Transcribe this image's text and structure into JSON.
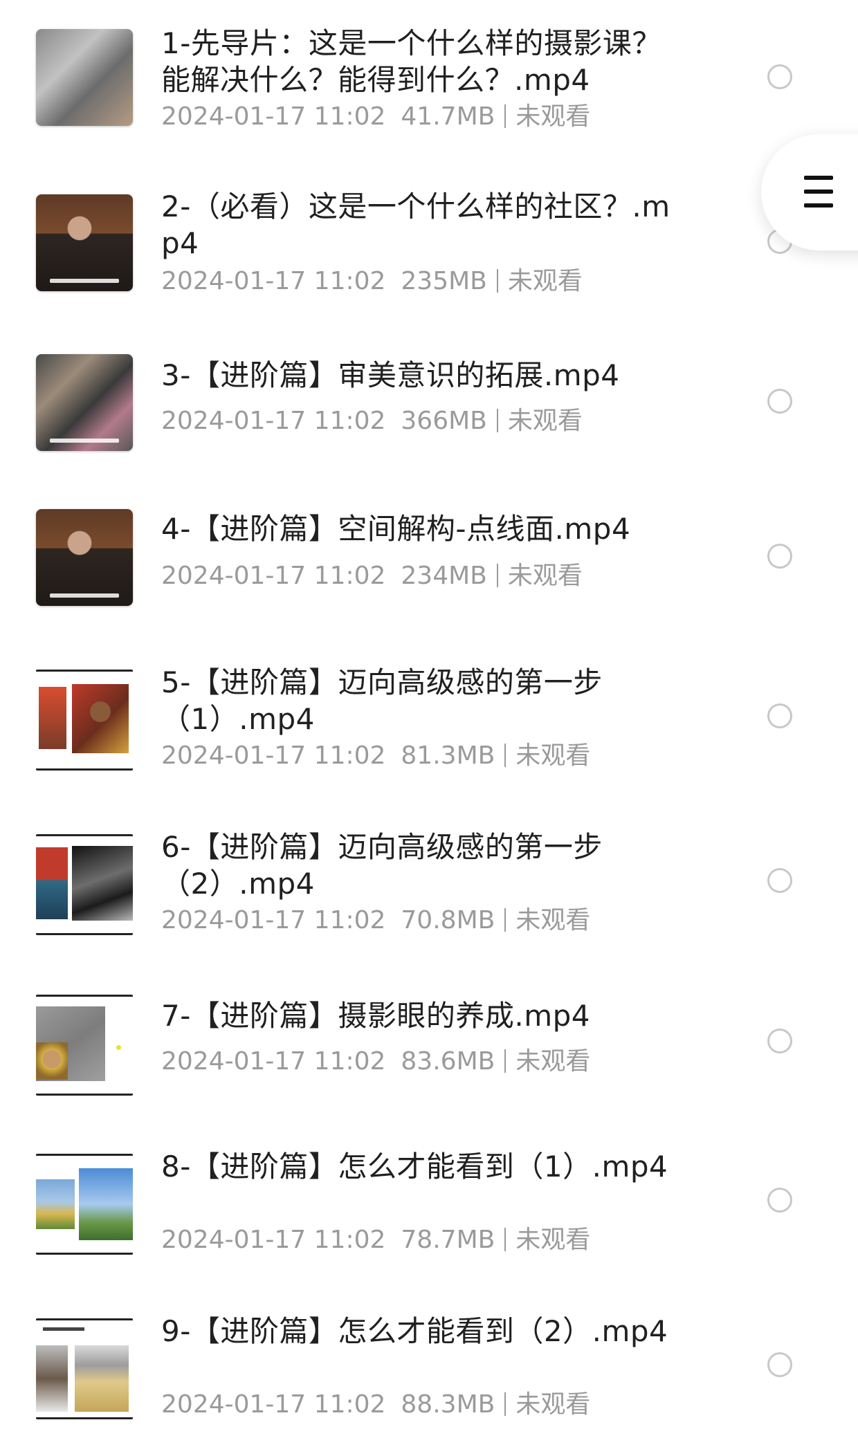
{
  "files": [
    {
      "title": "1-先导片：这是一个什么样的摄影课？能解决什么？能得到什么？.mp4",
      "date": "2024-01-17 11:02",
      "size": "41.7MB",
      "status": "未观看",
      "thumbnail": "street-photo"
    },
    {
      "title": "2-（必看）这是一个什么样的社区？.mp4",
      "date": "2024-01-17 11:02",
      "size": "235MB",
      "status": "未观看",
      "thumbnail": "video-presenter"
    },
    {
      "title": "3-【进阶篇】审美意识的拓展.mp4",
      "date": "2024-01-17 11:02",
      "size": "366MB",
      "status": "未观看",
      "thumbnail": "crowd-photo"
    },
    {
      "title": "4-【进阶篇】空间解构-点线面.mp4",
      "date": "2024-01-17 11:02",
      "size": "234MB",
      "status": "未观看",
      "thumbnail": "video-presenter"
    },
    {
      "title": "5-【进阶篇】迈向高级感的第一步（1）.mp4",
      "date": "2024-01-17 11:02",
      "size": "81.3MB",
      "status": "未观看",
      "thumbnail": "slide-portraits"
    },
    {
      "title": "6-【进阶篇】迈向高级感的第一步（2）.mp4",
      "date": "2024-01-17 11:02",
      "size": "70.8MB",
      "status": "未观看",
      "thumbnail": "slide-photos"
    },
    {
      "title": "7-【进阶篇】摄影眼的养成.mp4",
      "date": "2024-01-17 11:02",
      "size": "83.6MB",
      "status": "未观看",
      "thumbnail": "slide-child"
    },
    {
      "title": "8-【进阶篇】怎么才能看到（1）.mp4",
      "date": "2024-01-17 11:02",
      "size": "78.7MB",
      "status": "未观看",
      "thumbnail": "slide-landscape"
    },
    {
      "title": "9-【进阶篇】怎么才能看到（2）.mp4",
      "date": "2024-01-17 11:02",
      "size": "88.3MB",
      "status": "未观看",
      "thumbnail": "slide-people"
    }
  ],
  "menu_button": {
    "icon": "menu-icon"
  },
  "colors": {
    "title_text": "#202020",
    "meta_text": "#9a9a9a",
    "radio_border": "#c8c8c8",
    "background": "#ffffff"
  }
}
